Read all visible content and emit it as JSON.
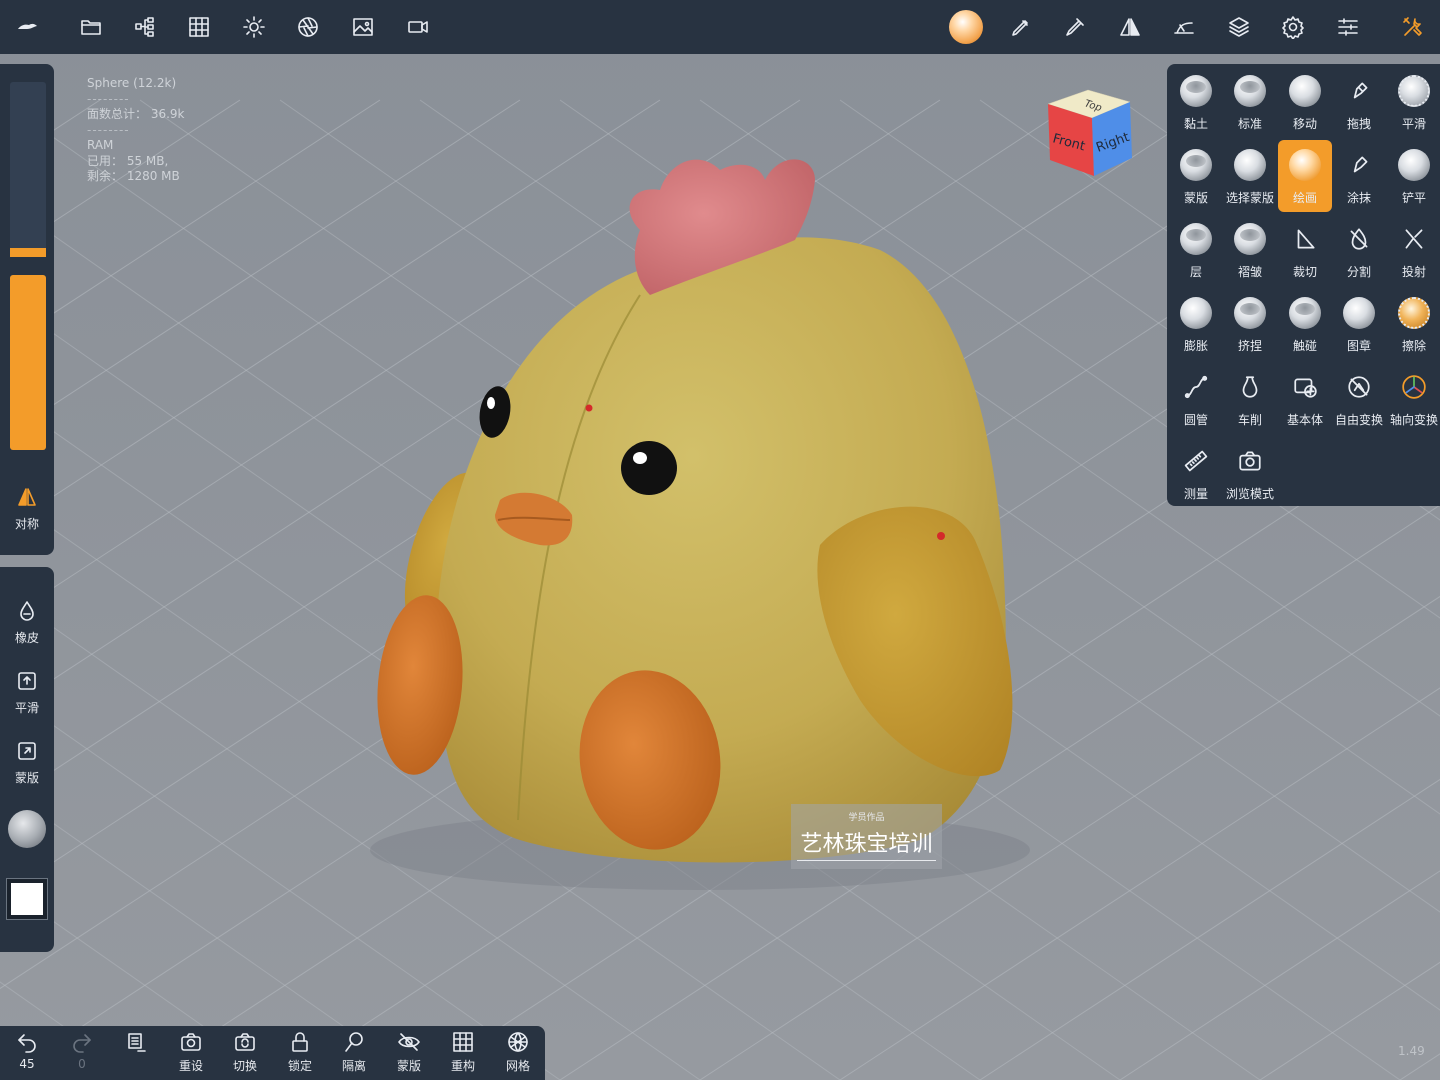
{
  "stats": {
    "object": "Sphere (12.2k)",
    "sep1": "--------",
    "faces_total": "面数总计： 36.9k",
    "sep2": "--------",
    "ram_label": "RAM",
    "ram_used": "已用： 55 MB,",
    "ram_free": "剩余： 1280 MB"
  },
  "viewcube": {
    "top": "Top",
    "front": "Front",
    "right": "Right"
  },
  "left_panel": {
    "radius_fraction": 0.05,
    "intensity_fraction": 1.0,
    "symmetry": "对称",
    "eraser": "橡皮",
    "smooth": "平滑",
    "mask": "蒙版"
  },
  "tools": [
    {
      "label": "黏土",
      "icon": "clay-icon"
    },
    {
      "label": "标准",
      "icon": "standard-icon"
    },
    {
      "label": "移动",
      "icon": "move-icon"
    },
    {
      "label": "拖拽",
      "icon": "drag-icon"
    },
    {
      "label": "平滑",
      "icon": "smooth-icon"
    },
    {
      "label": "蒙版",
      "icon": "mask-icon"
    },
    {
      "label": "选择蒙版",
      "icon": "select-mask-icon"
    },
    {
      "label": "绘画",
      "icon": "paint-icon",
      "active": true
    },
    {
      "label": "涂抹",
      "icon": "smudge-icon"
    },
    {
      "label": "铲平",
      "icon": "flatten-icon"
    },
    {
      "label": "层",
      "icon": "layer-icon"
    },
    {
      "label": "褶皱",
      "icon": "crease-icon"
    },
    {
      "label": "裁切",
      "icon": "trim-icon"
    },
    {
      "label": "分割",
      "icon": "split-icon"
    },
    {
      "label": "投射",
      "icon": "project-icon"
    },
    {
      "label": "膨胀",
      "icon": "inflate-icon"
    },
    {
      "label": "挤捏",
      "icon": "pinch-icon"
    },
    {
      "label": "触碰",
      "icon": "tube-touch-icon"
    },
    {
      "label": "图章",
      "icon": "stamp-icon"
    },
    {
      "label": "擦除",
      "icon": "erase-icon"
    },
    {
      "label": "圆管",
      "icon": "tube-icon"
    },
    {
      "label": "车削",
      "icon": "lathe-icon"
    },
    {
      "label": "基本体",
      "icon": "primitive-icon"
    },
    {
      "label": "自由变换",
      "icon": "free-transform-icon"
    },
    {
      "label": "轴向变换",
      "icon": "gizmo-icon"
    },
    {
      "label": "测量",
      "icon": "measure-icon"
    },
    {
      "label": "浏览模式",
      "icon": "camera-icon"
    }
  ],
  "bottom": {
    "undo": "45",
    "redo": "0",
    "reset": "重设",
    "switch": "切换",
    "lock": "锁定",
    "isolate": "隔离",
    "mask": "蒙版",
    "remesh": "重构",
    "mesh": "网格"
  },
  "version": "1.49",
  "watermark": {
    "small": "学员作品",
    "main": "艺林珠宝培训"
  },
  "colors": {
    "panel": "#283341",
    "accent": "#f39c2a",
    "chick_body": "#c9b45a",
    "comb": "#d9777a",
    "feet": "#d9762a"
  }
}
